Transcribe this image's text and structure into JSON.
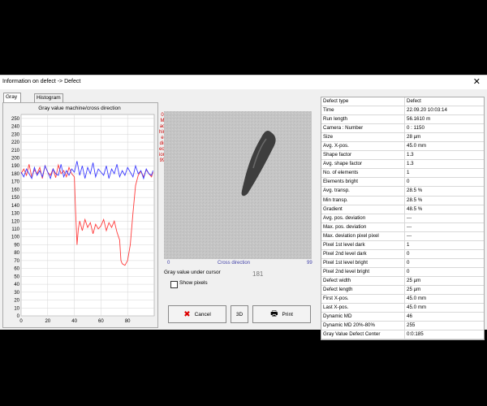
{
  "window": {
    "title": "Information on defect  ->  Defect",
    "close_glyph": "✕"
  },
  "tabs": [
    {
      "label": "Gray value",
      "active": true
    },
    {
      "label": "Histogram",
      "active": false
    }
  ],
  "chart_data": {
    "type": "line",
    "title": "Gray value machine/cross direction",
    "xlabel": "",
    "ylabel": "",
    "xlim": [
      0,
      100
    ],
    "ylim": [
      0,
      255
    ],
    "yticks": [
      0,
      10,
      20,
      30,
      40,
      50,
      60,
      70,
      80,
      90,
      100,
      110,
      120,
      130,
      140,
      150,
      160,
      170,
      180,
      190,
      200,
      210,
      220,
      230,
      240,
      250
    ],
    "xticks": [
      0,
      20,
      40,
      60,
      80
    ],
    "grid": true,
    "series": [
      {
        "color": "#ff3b3b",
        "x": [
          0,
          2,
          4,
          6,
          8,
          10,
          12,
          14,
          16,
          18,
          20,
          22,
          24,
          26,
          28,
          30,
          32,
          34,
          36,
          38,
          40,
          41,
          42,
          43,
          44,
          46,
          48,
          50,
          52,
          54,
          56,
          58,
          60,
          62,
          64,
          66,
          68,
          70,
          72,
          74,
          75,
          76,
          78,
          80,
          82,
          84,
          86,
          88,
          90,
          92,
          94,
          96,
          98,
          99
        ],
        "y": [
          180,
          186,
          178,
          192,
          176,
          185,
          180,
          188,
          174,
          190,
          182,
          178,
          186,
          175,
          191,
          180,
          184,
          176,
          188,
          180,
          176,
          130,
          90,
          110,
          120,
          108,
          122,
          112,
          118,
          104,
          116,
          110,
          114,
          122,
          108,
          118,
          112,
          120,
          106,
          96,
          70,
          66,
          64,
          70,
          90,
          130,
          165,
          178,
          183,
          176,
          185,
          180,
          176,
          182
        ]
      },
      {
        "color": "#3b3bff",
        "x": [
          0,
          2,
          4,
          6,
          8,
          10,
          12,
          14,
          16,
          18,
          20,
          22,
          24,
          26,
          28,
          30,
          32,
          34,
          36,
          38,
          40,
          42,
          44,
          46,
          48,
          50,
          52,
          54,
          56,
          58,
          60,
          62,
          64,
          66,
          68,
          70,
          72,
          74,
          76,
          78,
          80,
          82,
          84,
          86,
          88,
          90,
          92,
          94,
          96,
          98,
          99
        ],
        "y": [
          182,
          176,
          186,
          180,
          174,
          188,
          178,
          184,
          176,
          190,
          182,
          174,
          186,
          180,
          178,
          192,
          176,
          184,
          178,
          186,
          182,
          196,
          178,
          190,
          174,
          188,
          180,
          194,
          176,
          186,
          182,
          178,
          190,
          174,
          186,
          180,
          192,
          176,
          184,
          178,
          188,
          182,
          176,
          190,
          180,
          184,
          174,
          186,
          180,
          178,
          184
        ]
      }
    ]
  },
  "image_panel": {
    "vertical_label": "Machine direction",
    "vertical_label_top": "0",
    "vertical_label_bottom": "99",
    "cross_label": "Cross direction",
    "tick_start": "0",
    "tick_end": "99",
    "gray_value_label": "Gray value under cursor",
    "gray_value": "181",
    "show_pixels_label": "Show pixels"
  },
  "buttons": {
    "cancel": "Cancel",
    "cancel_icon": "✖",
    "view3d": "3D",
    "print": "Print",
    "print_icon": "🖶"
  },
  "properties": [
    {
      "key": "Defect type",
      "value": "Defect"
    },
    {
      "key": "Time",
      "value": "22.09.20  10:03:14"
    },
    {
      "key": "Run length",
      "value": "56.1610 m"
    },
    {
      "key": "Camera : Number",
      "value": "0  :  1150"
    },
    {
      "key": "Size",
      "value": "28 µm"
    },
    {
      "key": "Avg. X-pos.",
      "value": "45.0 mm"
    },
    {
      "key": "Shape factor",
      "value": "1.3"
    },
    {
      "key": "Avg. shape factor",
      "value": "1.3"
    },
    {
      "key": "No. of elements",
      "value": "1"
    },
    {
      "key": "Elements bright",
      "value": "0"
    },
    {
      "key": "Avg. transp.",
      "value": "28.5 %"
    },
    {
      "key": "Min transp.",
      "value": "28.5 %"
    },
    {
      "key": "Gradient",
      "value": "48.5 %"
    },
    {
      "key": "Avg. pos. deviation",
      "value": "---"
    },
    {
      "key": "Max. pos. deviation",
      "value": "---"
    },
    {
      "key": "Max. deviation pixel pixel",
      "value": "---"
    },
    {
      "key": "Pixel 1st level dark",
      "value": "1"
    },
    {
      "key": "Pixel 2nd level dark",
      "value": "0"
    },
    {
      "key": "Pixel 1st level bright",
      "value": "0"
    },
    {
      "key": "Pixel 2nd level bright",
      "value": "0"
    },
    {
      "key": "Defect width",
      "value": "25 µm"
    },
    {
      "key": "Defect length",
      "value": "25 µm"
    },
    {
      "key": "First X-pos.",
      "value": "45.0 mm"
    },
    {
      "key": "Last X-pos.",
      "value": "45.0 mm"
    },
    {
      "key": "Dynamic MD",
      "value": "46"
    },
    {
      "key": "Dynamic MD 20%-80%",
      "value": "255"
    },
    {
      "key": "Gray Value Defect Center",
      "value": "0:0:185"
    }
  ]
}
